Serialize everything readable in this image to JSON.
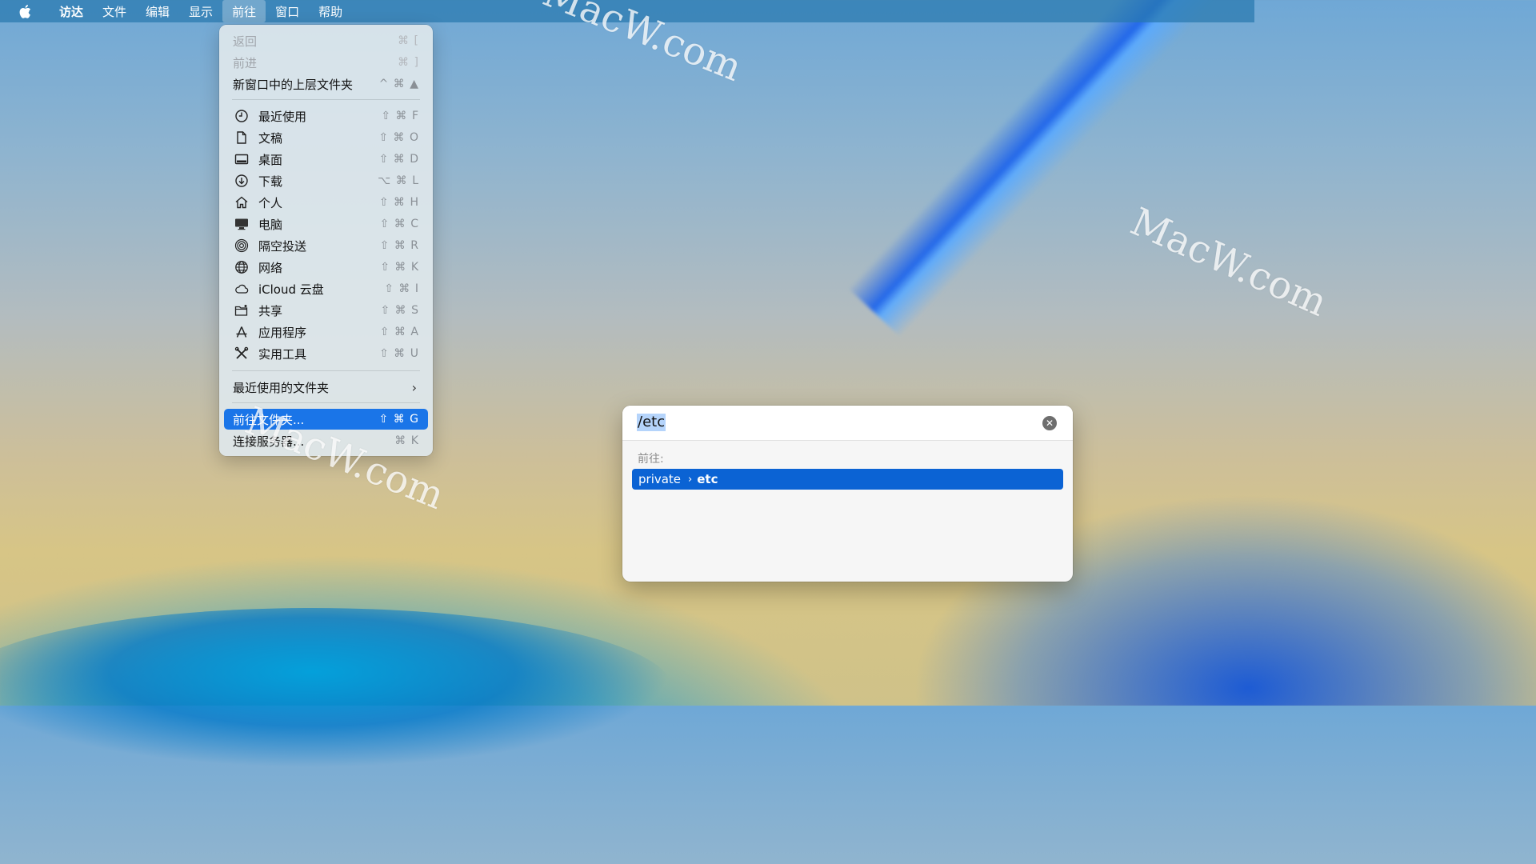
{
  "menubar": {
    "apple_icon": "apple-logo",
    "items": [
      {
        "label": "访达",
        "bold": true
      },
      {
        "label": "文件"
      },
      {
        "label": "编辑"
      },
      {
        "label": "显示"
      },
      {
        "label": "前往",
        "active": true
      },
      {
        "label": "窗口"
      },
      {
        "label": "帮助"
      }
    ]
  },
  "go_menu": {
    "back": {
      "label": "返回",
      "shortcut": "⌘ [",
      "disabled": true
    },
    "forward": {
      "label": "前进",
      "shortcut": "⌘ ]",
      "disabled": true
    },
    "enclosing": {
      "label": "新窗口中的上层文件夹",
      "shortcut": "^ ⌘ ▲"
    },
    "places": [
      {
        "label": "最近使用",
        "shortcut": "⇧ ⌘ F",
        "icon": "clock-icon"
      },
      {
        "label": "文稿",
        "shortcut": "⇧ ⌘ O",
        "icon": "document-icon"
      },
      {
        "label": "桌面",
        "shortcut": "⇧ ⌘ D",
        "icon": "desktop-icon"
      },
      {
        "label": "下载",
        "shortcut": "⌥ ⌘ L",
        "icon": "download-icon"
      },
      {
        "label": "个人",
        "shortcut": "⇧ ⌘ H",
        "icon": "home-icon"
      },
      {
        "label": "电脑",
        "shortcut": "⇧ ⌘ C",
        "icon": "computer-icon"
      },
      {
        "label": "隔空投送",
        "shortcut": "⇧ ⌘ R",
        "icon": "airdrop-icon"
      },
      {
        "label": "网络",
        "shortcut": "⇧ ⌘ K",
        "icon": "globe-icon"
      },
      {
        "label": "iCloud 云盘",
        "shortcut": "⇧ ⌘ I",
        "icon": "cloud-icon"
      },
      {
        "label": "共享",
        "shortcut": "⇧ ⌘ S",
        "icon": "shared-folder-icon"
      },
      {
        "label": "应用程序",
        "shortcut": "⇧ ⌘ A",
        "icon": "applications-icon"
      },
      {
        "label": "实用工具",
        "shortcut": "⇧ ⌘ U",
        "icon": "tools-icon"
      }
    ],
    "recent_folders": {
      "label": "最近使用的文件夹",
      "icon": "chevron-right-icon"
    },
    "go_to_folder": {
      "label": "前往文件夹...",
      "shortcut": "⇧ ⌘ G",
      "selected": true
    },
    "connect_server": {
      "label": "连接服务器...",
      "shortcut": "⌘ K"
    }
  },
  "dialog": {
    "path_value": "/etc",
    "go_label": "前往:",
    "result": {
      "segment1": "private",
      "separator": "›",
      "segment2": "etc"
    },
    "clear_icon": "clear-circle-icon"
  },
  "watermarks": [
    "MacW.com",
    "MacW.com",
    "MacW.com"
  ],
  "colors": {
    "selection_blue": "#1a75e8",
    "result_blue": "#0b63d4",
    "input_highlight": "#b5d4fb"
  }
}
